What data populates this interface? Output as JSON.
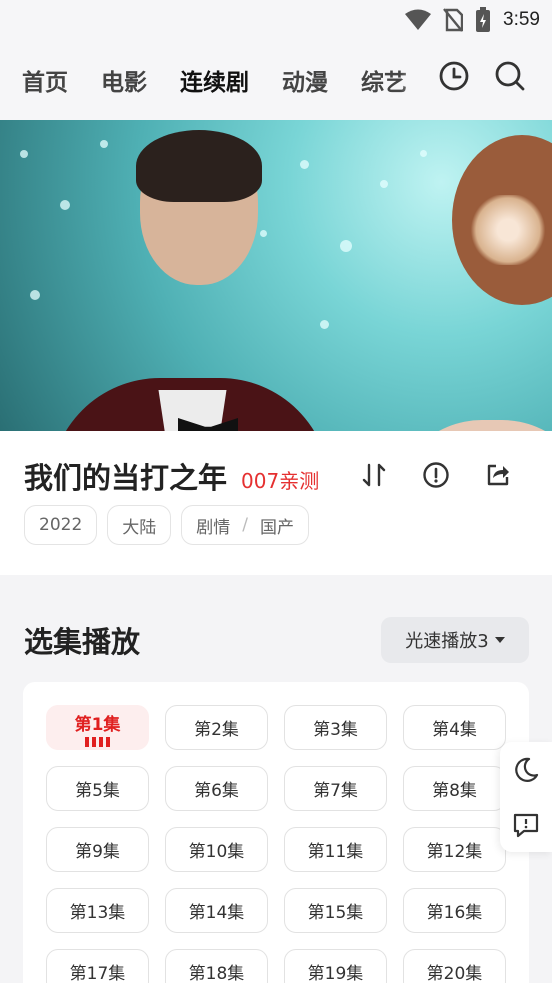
{
  "status_bar": {
    "time": "3:59",
    "icons": [
      "wifi-icon",
      "no-sim-icon",
      "battery-charging-icon"
    ]
  },
  "nav": {
    "tabs": [
      {
        "label": "首页",
        "active": false
      },
      {
        "label": "电影",
        "active": false
      },
      {
        "label": "连续剧",
        "active": true
      },
      {
        "label": "动漫",
        "active": false
      },
      {
        "label": "综艺",
        "active": false
      }
    ],
    "actions": [
      "history-clock-icon",
      "search-icon"
    ],
    "accent_color": "#f7c948"
  },
  "video": {
    "description_icon": "video-player"
  },
  "show": {
    "title": "我们的当打之年",
    "source": "007亲测",
    "source_color": "#e53030",
    "actions": [
      "sort-icon",
      "report-icon",
      "share-icon"
    ],
    "tags": {
      "year": "2022",
      "region": "大陆",
      "genre1": "剧情",
      "genre2": "国产"
    }
  },
  "episodes": {
    "section_title": "选集播放",
    "line_selector": "光速播放3",
    "active_color": "#e02020",
    "items": [
      {
        "label": "第1集",
        "active": true
      },
      {
        "label": "第2集"
      },
      {
        "label": "第3集"
      },
      {
        "label": "第4集"
      },
      {
        "label": "第5集"
      },
      {
        "label": "第6集"
      },
      {
        "label": "第7集"
      },
      {
        "label": "第8集"
      },
      {
        "label": "第9集"
      },
      {
        "label": "第10集"
      },
      {
        "label": "第11集"
      },
      {
        "label": "第12集"
      },
      {
        "label": "第13集"
      },
      {
        "label": "第14集"
      },
      {
        "label": "第15集"
      },
      {
        "label": "第16集"
      },
      {
        "label": "第17集"
      },
      {
        "label": "第18集"
      },
      {
        "label": "第19集"
      },
      {
        "label": "第20集"
      }
    ]
  },
  "floating": {
    "buttons": [
      "night-mode-icon",
      "feedback-icon"
    ]
  }
}
